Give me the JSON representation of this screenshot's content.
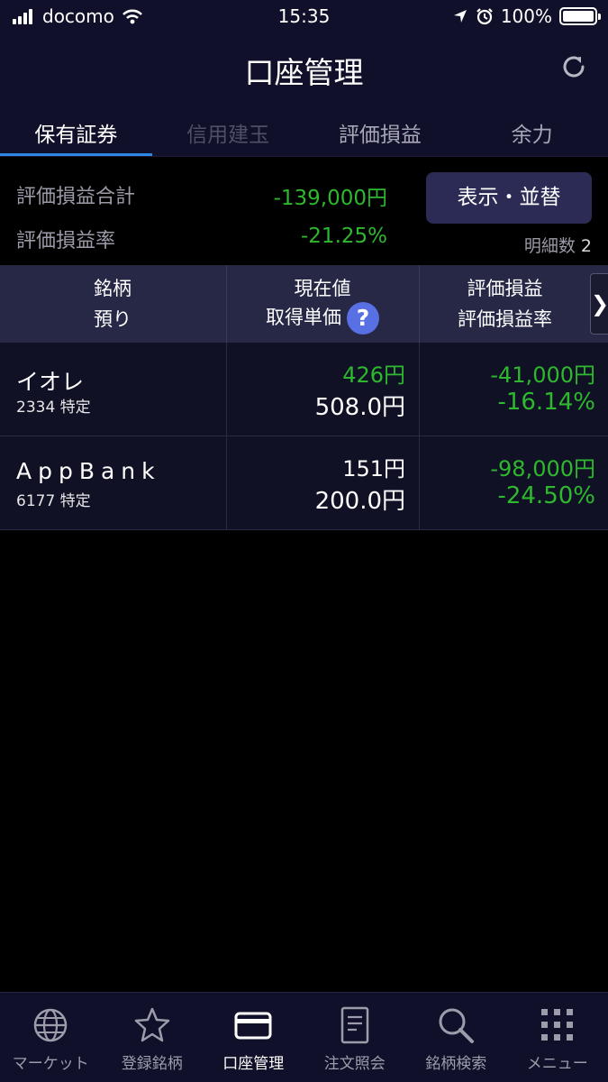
{
  "status_bar": {
    "carrier": "docomo",
    "time": "15:35",
    "battery": "100%"
  },
  "header": {
    "title": "口座管理"
  },
  "tabs": [
    {
      "label": "保有証券",
      "state": "active"
    },
    {
      "label": "信用建玉",
      "state": "disabled"
    },
    {
      "label": "評価損益",
      "state": "normal"
    },
    {
      "label": "余力",
      "state": "normal"
    }
  ],
  "summary": {
    "total_label": "評価損益合計",
    "total_value": "-139,000円",
    "rate_label": "評価損益率",
    "rate_value": "-21.25%",
    "sort_button": "表示・並替",
    "detail_label": "明細数",
    "detail_count": "2"
  },
  "table": {
    "headers": {
      "col1_line1": "銘柄",
      "col1_line2": "預り",
      "col2_line1": "現在値",
      "col2_line2": "取得単価",
      "col3_line1": "評価損益",
      "col3_line2": "評価損益率"
    },
    "rows": [
      {
        "name": "イオレ",
        "code": "2334 特定",
        "price": "426円",
        "cost": "508.0円",
        "pl": "-41,000円",
        "pl_rate": "-16.14%"
      },
      {
        "name": "AppBank",
        "code": "6177 特定",
        "price": "151円",
        "cost": "200.0円",
        "pl": "-98,000円",
        "pl_rate": "-24.50%"
      }
    ]
  },
  "bottom_nav": [
    {
      "label": "マーケット",
      "icon": "globe-icon"
    },
    {
      "label": "登録銘柄",
      "icon": "star-icon"
    },
    {
      "label": "口座管理",
      "icon": "card-icon",
      "active": true
    },
    {
      "label": "注文照会",
      "icon": "document-icon"
    },
    {
      "label": "銘柄検索",
      "icon": "search-icon"
    },
    {
      "label": "メニュー",
      "icon": "grid-menu-icon"
    }
  ],
  "colors": {
    "profit_loss": "#2db82d",
    "tab_indicator": "#2f86e6",
    "help_icon": "#5870e3"
  }
}
